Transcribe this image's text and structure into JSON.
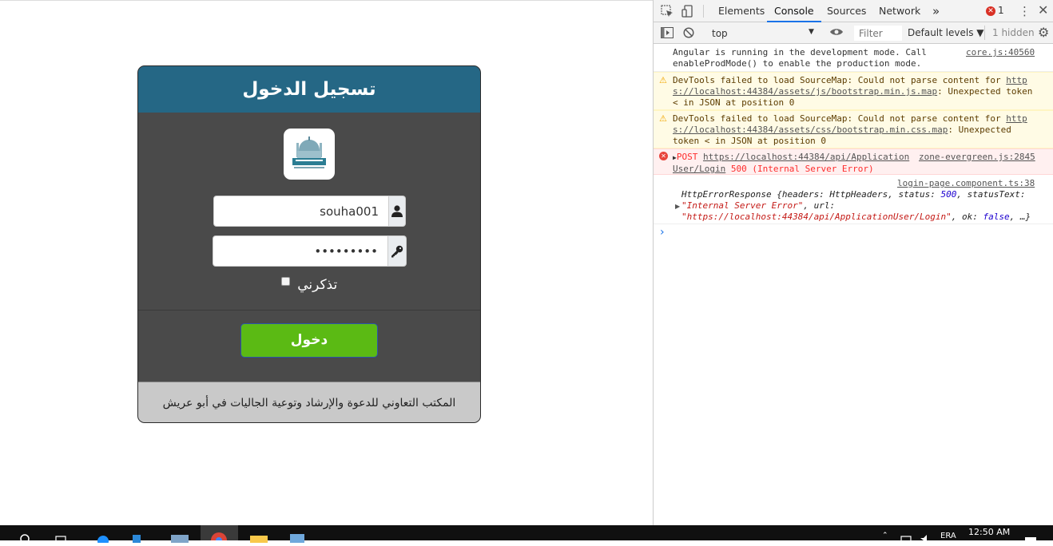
{
  "login": {
    "title": "تسجيل الدخول",
    "username_value": "souha001",
    "password_value": "•••••••••",
    "remember_label": "تذكرني",
    "submit_label": "دخول",
    "footer_text": "المكتب التعاوني للدعوة والإرشاد وتوعية الجاليات في أبو عريش"
  },
  "devtools": {
    "tabs": [
      "Elements",
      "Console",
      "Sources",
      "Network"
    ],
    "active_tab": "Console",
    "more_tabs": "»",
    "error_count": "1",
    "context": "top",
    "filter_placeholder": "Filter",
    "levels": "Default levels ▼",
    "hidden": "1 hidden",
    "messages": [
      {
        "line1": "Angular is running in the development mode. Call",
        "line2": "enableProdMode() to enable the production mode.",
        "source": "core.js:40560"
      },
      {
        "line1a": "DevTools failed to load SourceMap: Could not parse content for ",
        "line1b": "http",
        "line2a": "s://localhost:44384/assets/js/bootstrap.min.js.map",
        "line2b": ": Unexpected token",
        "line3": "< in JSON at position 0"
      },
      {
        "line1a": "DevTools failed to load SourceMap: Could not parse content for ",
        "line1b": "http",
        "line2a": "s://localhost:44384/assets/css/bootstrap.min.css.map",
        "line2b": ": Unexpected",
        "line3": "token < in JSON at position 0"
      },
      {
        "method": "POST",
        "url1": "https://localhost:44384/api/Application",
        "source": "zone-evergreen.js:2845",
        "url2": "User/Login",
        "status": "500 (Internal Server Error)"
      },
      {
        "source": "login-page.component.ts:38",
        "obj": "HttpErrorResponse {headers: HttpHeaders, status: ",
        "status_num": "500",
        "status_text_key": ", statusText:",
        "status_text_val": "\"Internal Server Error\"",
        "url_key": ", url:",
        "url_val": "\"https://localhost:44384/api/ApplicationUser/Login\"",
        "ok_key": ", ok: ",
        "ok_val": "false",
        "tail": ", …}"
      }
    ],
    "prompt": "›"
  },
  "taskbar": {
    "time": "12:50 AM",
    "lang": "ERA"
  },
  "colors": {
    "header": "#256785",
    "body": "#4a4a4a",
    "button": "#5bba14",
    "footer": "#c9c9c9"
  }
}
